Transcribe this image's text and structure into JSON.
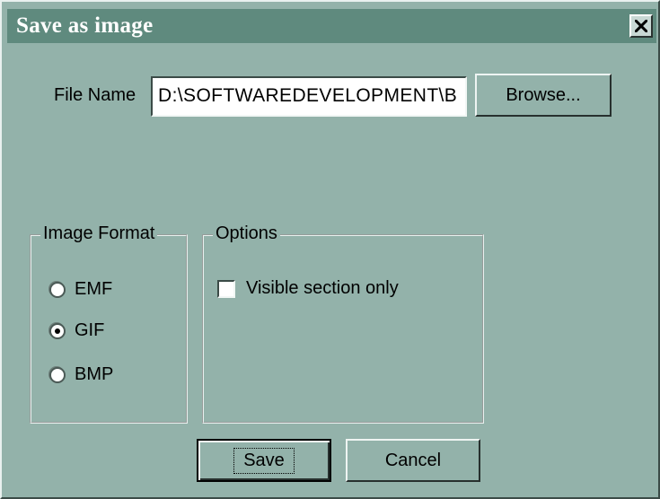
{
  "window": {
    "title": "Save as image",
    "close_glyph": "✖"
  },
  "file": {
    "label": "File Name",
    "value": "D:\\SOFTWAREDEVELOPMENT\\B",
    "browse_label": "Browse..."
  },
  "image_format": {
    "title": "Image Format",
    "options": [
      {
        "label": "EMF",
        "selected": false
      },
      {
        "label": "GIF",
        "selected": true
      },
      {
        "label": "BMP",
        "selected": false
      }
    ]
  },
  "options": {
    "title": "Options",
    "visible_section_label": "Visible section only",
    "visible_section_checked": false
  },
  "buttons": {
    "save_label": "Save",
    "cancel_label": "Cancel"
  },
  "icons": {
    "close": "close-icon"
  }
}
